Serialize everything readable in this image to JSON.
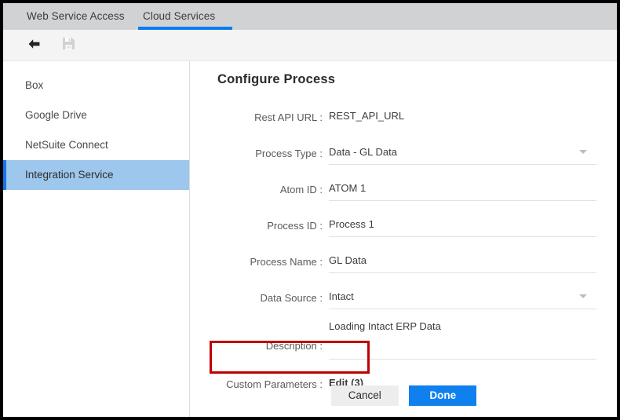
{
  "tabs": [
    {
      "label": "Web Service Access",
      "selected": false
    },
    {
      "label": "Cloud Services",
      "selected": true
    }
  ],
  "toolbar": {
    "back_icon": "back-arrow-icon",
    "save_icon": "save-disk-icon"
  },
  "sidebar": {
    "items": [
      {
        "label": "Box",
        "selected": false
      },
      {
        "label": "Google Drive",
        "selected": false
      },
      {
        "label": "NetSuite Connect",
        "selected": false
      },
      {
        "label": "Integration Service",
        "selected": true
      }
    ]
  },
  "panel": {
    "title": "Configure Process",
    "fields": [
      {
        "label": "Rest API URL :",
        "value": "REST_API_URL",
        "type": "text",
        "underline": false
      },
      {
        "label": "Process Type :",
        "value": "Data - GL Data",
        "type": "select",
        "underline": true
      },
      {
        "label": "Atom ID :",
        "value": "ATOM 1",
        "type": "text",
        "underline": true
      },
      {
        "label": "Process ID :",
        "value": "Process 1",
        "type": "text",
        "underline": true
      },
      {
        "label": "Process Name :",
        "value": "GL Data",
        "type": "text",
        "underline": true
      },
      {
        "label": "Data Source :",
        "value": "Intact",
        "type": "select",
        "underline": true
      },
      {
        "label": "Description :",
        "value": "Loading Intact ERP Data",
        "type": "textarea",
        "underline": true
      }
    ],
    "custom_parameters": {
      "label": "Custom Parameters :",
      "link_text": "Edit (3)"
    },
    "buttons": {
      "cancel": "Cancel",
      "done": "Done"
    }
  },
  "colors": {
    "accent_blue": "#0b7bf0",
    "button_blue": "#1180ef",
    "link_blue": "#1a78e0",
    "selected_item": "#9dc7ec",
    "selected_border": "#1a73e8",
    "tabbar_gray": "#d0d2d3",
    "toolbar_gray": "#f4f4f4",
    "highlight_red": "#c00000"
  }
}
